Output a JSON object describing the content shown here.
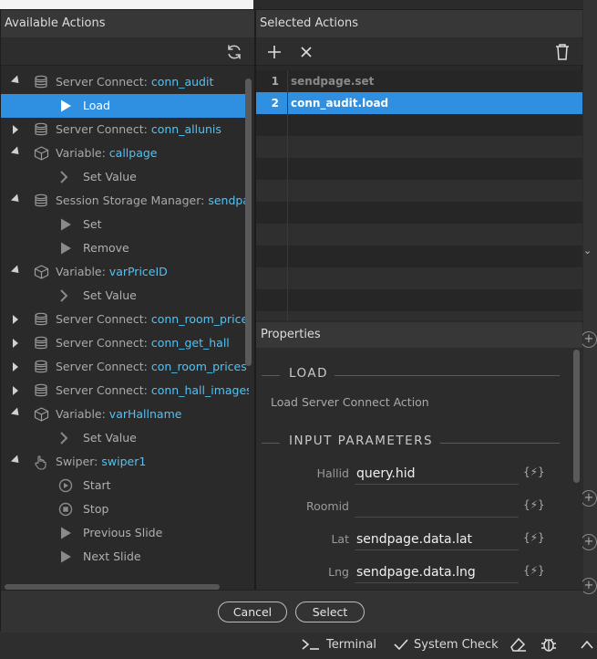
{
  "available": {
    "title": "Available Actions",
    "items": [
      {
        "prefix": "Server Connect: ",
        "value": "conn_audit",
        "caret": "open",
        "icon": "database-icon"
      },
      {
        "label": "Load",
        "child": true,
        "icon": "play-icon",
        "selected": true
      },
      {
        "prefix": "Server Connect: ",
        "value": "conn_allunis",
        "caret": "closed",
        "icon": "database-icon"
      },
      {
        "prefix": "Variable: ",
        "value": "callpage",
        "caret": "open",
        "icon": "cube-icon"
      },
      {
        "label": "Set Value",
        "child": true,
        "icon": "chevron-right-icon"
      },
      {
        "prefix": "Session Storage Manager: ",
        "value": "sendpage",
        "caret": "open",
        "icon": "database-icon"
      },
      {
        "label": "Set",
        "child": true,
        "icon": "play-icon"
      },
      {
        "label": "Remove",
        "child": true,
        "icon": "play-icon"
      },
      {
        "prefix": "Variable: ",
        "value": "varPriceID",
        "caret": "open",
        "icon": "cube-icon"
      },
      {
        "label": "Set Value",
        "child": true,
        "icon": "chevron-right-icon"
      },
      {
        "prefix": "Server Connect: ",
        "value": "conn_room_price_by",
        "caret": "closed",
        "icon": "database-icon"
      },
      {
        "prefix": "Server Connect: ",
        "value": "conn_get_hall",
        "caret": "closed",
        "icon": "database-icon"
      },
      {
        "prefix": "Server Connect: ",
        "value": "con_room_prices",
        "caret": "closed",
        "icon": "database-icon"
      },
      {
        "prefix": "Server Connect: ",
        "value": "conn_hall_images",
        "caret": "closed",
        "icon": "database-icon"
      },
      {
        "prefix": "Variable: ",
        "value": "varHallname",
        "caret": "open",
        "icon": "cube-icon"
      },
      {
        "label": "Set Value",
        "child": true,
        "icon": "chevron-right-icon"
      },
      {
        "prefix": "Swiper: ",
        "value": "swiper1",
        "caret": "open",
        "icon": "hand-icon"
      },
      {
        "label": "Start",
        "child": true,
        "icon": "play-circle-icon"
      },
      {
        "label": "Stop",
        "child": true,
        "icon": "stop-circle-icon"
      },
      {
        "label": "Previous Slide",
        "child": true,
        "icon": "play-icon"
      },
      {
        "label": "Next Slide",
        "child": true,
        "icon": "play-icon"
      }
    ]
  },
  "selected": {
    "title": "Selected Actions",
    "items": [
      {
        "num": "1",
        "label": "sendpage.set"
      },
      {
        "num": "2",
        "label": "conn_audit.load",
        "active": true
      }
    ]
  },
  "properties": {
    "title": "Properties",
    "section1": "LOAD",
    "description": "Load Server Connect Action",
    "section2": "INPUT PARAMETERS",
    "params": [
      {
        "label": "Hallid",
        "value": "query.hid"
      },
      {
        "label": "Roomid",
        "value": ""
      },
      {
        "label": "Lat",
        "value": "sendpage.data.lat"
      },
      {
        "label": "Lng",
        "value": "sendpage.data.lng"
      }
    ],
    "fx_label": "{⚡}"
  },
  "footer": {
    "cancel": "Cancel",
    "select": "Select"
  },
  "statusbar": {
    "terminal": "Terminal",
    "system_check": "System Check"
  },
  "colors": {
    "accent": "#2f8fe0",
    "value_text": "#4fc3f7"
  }
}
